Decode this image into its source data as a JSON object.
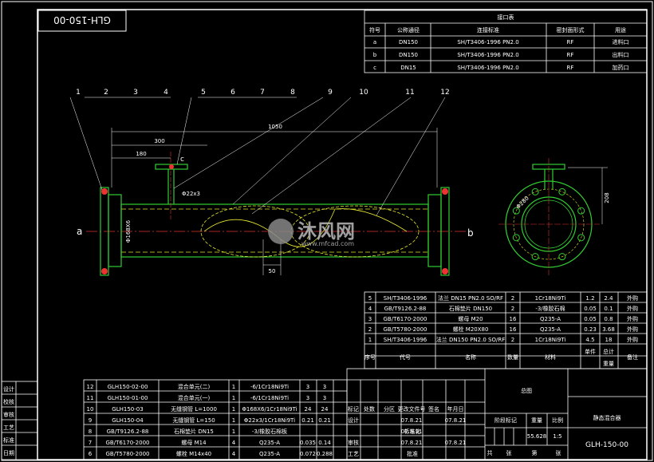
{
  "drawing_no_box": "GLH-150-00",
  "nozzle_table": {
    "title": "接口表",
    "headers": [
      "符号",
      "公称通径",
      "连接标准",
      "密封面形式",
      "用途"
    ],
    "rows": [
      [
        "a",
        "DN150",
        "SH/T3406-1996 PN2.0",
        "RF",
        "进料口"
      ],
      [
        "b",
        "DN150",
        "SH/T3406-1996 PN2.0",
        "RF",
        "出料口"
      ],
      [
        "c",
        "DN15",
        "SH/T3406-1996 PN2.0",
        "RF",
        "加药口"
      ]
    ]
  },
  "balloons": [
    "1",
    "2",
    "3",
    "4",
    "5",
    "6",
    "7",
    "8",
    "9",
    "10",
    "11",
    "12"
  ],
  "dimensions": {
    "overall": "1050",
    "d300": "300",
    "d180": "180",
    "pipe_dia": "Φ168X6",
    "nozzle": "Φ22x3",
    "d50": "50",
    "flange_dia": "Φ280",
    "side_height": "208"
  },
  "labels": {
    "inlet": "a",
    "outlet": "b",
    "nozzle": "c"
  },
  "watermark": {
    "main": "沐风网",
    "url": "www.mfcad.com"
  },
  "parts_upper": [
    [
      "5",
      "SH/T3406-1996",
      "法兰 DN15 PN2.0 SO/RF",
      "2",
      "1Cr18Ni9Ti",
      "1.2",
      "2.4",
      "外购"
    ],
    [
      "4",
      "GB/T9126.2-88",
      "石棉垫片 DN150",
      "2",
      "-3/橡胶石棉",
      "0.05",
      "0.1",
      "外购"
    ],
    [
      "3",
      "GB/T6170-2000",
      "螺母 M20",
      "16",
      "Q235-A",
      "0.05",
      "0.8",
      "外购"
    ],
    [
      "2",
      "GB/T5780-2000",
      "螺栓 M20X80",
      "16",
      "Q235-A",
      "0.23",
      "3.68",
      "外购"
    ],
    [
      "1",
      "SH/T3406-1996",
      "法兰 DN150 PN2.0 SO/RF",
      "2",
      "1Cr18Ni9Ti",
      "4.5",
      "18",
      "外购"
    ]
  ],
  "parts_header": [
    "序号",
    "代号",
    "名称",
    "数量",
    "材料",
    "单件",
    "总计",
    "备注"
  ],
  "parts_header_sub": "重量",
  "parts_lower": [
    [
      "12",
      "GLH150-02-00",
      "混合单元(二)",
      "1",
      "-6/1Cr18Ni9Ti",
      "3",
      "3",
      ""
    ],
    [
      "11",
      "GLH150-01-00",
      "混合单元(一)",
      "1",
      "-6/1Cr18Ni9Ti",
      "3",
      "3",
      ""
    ],
    [
      "10",
      "GLH150-03",
      "无缝钢管 L=1000",
      "1",
      "Φ168X6/1Cr18Ni9Ti",
      "24",
      "24",
      ""
    ],
    [
      "9",
      "GLH150-04",
      "无缝钢管 L=150",
      "1",
      "Φ22x3/1Cr18Ni9Ti",
      "0.21",
      "0.21",
      ""
    ],
    [
      "8",
      "GB/T9126.2-88",
      "石棉垫片 DN15",
      "1",
      "-3/橡胶石棉板",
      "",
      "",
      ""
    ],
    [
      "7",
      "GB/T6170-2000",
      "螺母 M14",
      "4",
      "Q235-A",
      "0.035",
      "0.14",
      ""
    ],
    [
      "6",
      "GB/T5780-2000",
      "螺栓 M14x40",
      "4",
      "Q235-A",
      "0.072",
      "0.288",
      ""
    ]
  ],
  "left_labels": [
    "设计",
    "校核",
    "审核",
    "工艺",
    "标准",
    "日期"
  ],
  "title_block": {
    "proj": "总图",
    "name": "静态混合器",
    "drawing_no": "GLH-150-00",
    "weight_label": "重量",
    "weight": "55.628",
    "scale_label": "比例",
    "scale": "1:5",
    "stage_label": "阶段标记",
    "date": "07.8.21",
    "sheet_labels": [
      "共",
      "张",
      "第",
      "张"
    ]
  },
  "rev_row_labels": [
    "标记",
    "处数",
    "分区",
    "更改文件号",
    "签名",
    "年月日"
  ],
  "roles": [
    "设计",
    "标准化",
    "审核",
    "工艺",
    "批准"
  ]
}
